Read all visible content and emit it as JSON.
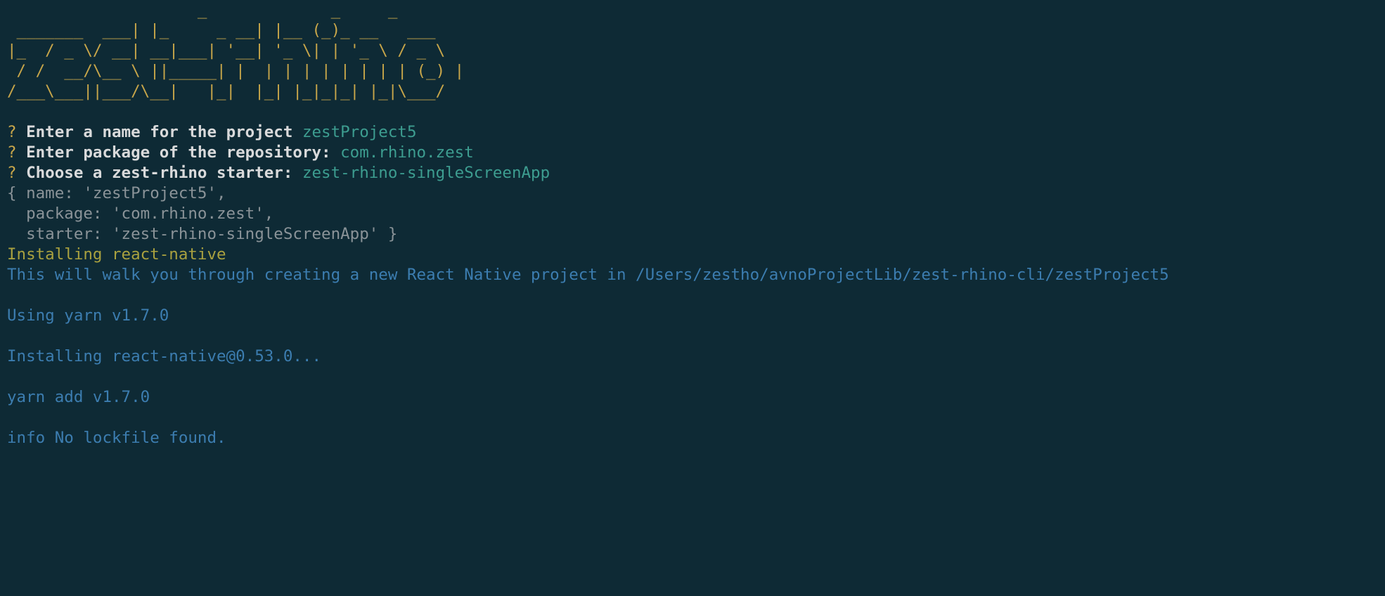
{
  "ascii_art": {
    "l1": "                    _             _     _                 ",
    "l2": " _______  ___| |_     _ __| |__ (_)_ __   ___  ",
    "l3": "|_  / _ \\/ __| __|___| '__| '_ \\| | '_ \\ / _ \\ ",
    "l4": " / /  __/\\__ \\ ||_____| |  | | | | | | | | (_) |",
    "l5": "/___\\___||___/\\__|   |_|  |_| |_|_|_| |_|\\___/ "
  },
  "prompts": {
    "marker": "?",
    "name_prompt": "Enter a name for the project",
    "name_value": "zestProject5",
    "package_prompt": "Enter package of the repository:",
    "package_value": "com.rhino.zest",
    "starter_prompt": "Choose a zest-rhino starter:",
    "starter_value": "zest-rhino-singleScreenApp"
  },
  "object_dump": {
    "l1": "{ name: 'zestProject5',",
    "l2": "  package: 'com.rhino.zest',",
    "l3": "  starter: 'zest-rhino-singleScreenApp' }"
  },
  "log": {
    "installing": "Installing react-native",
    "walkthrough": "This will walk you through creating a new React Native project in /Users/zestho/avnoProjectLib/zest-rhino-cli/zestProject5",
    "using_yarn": "Using yarn v1.7.0",
    "installing_rn": "Installing react-native@0.53.0...",
    "yarn_add": "yarn add v1.7.0",
    "no_lockfile": "info No lockfile found."
  }
}
